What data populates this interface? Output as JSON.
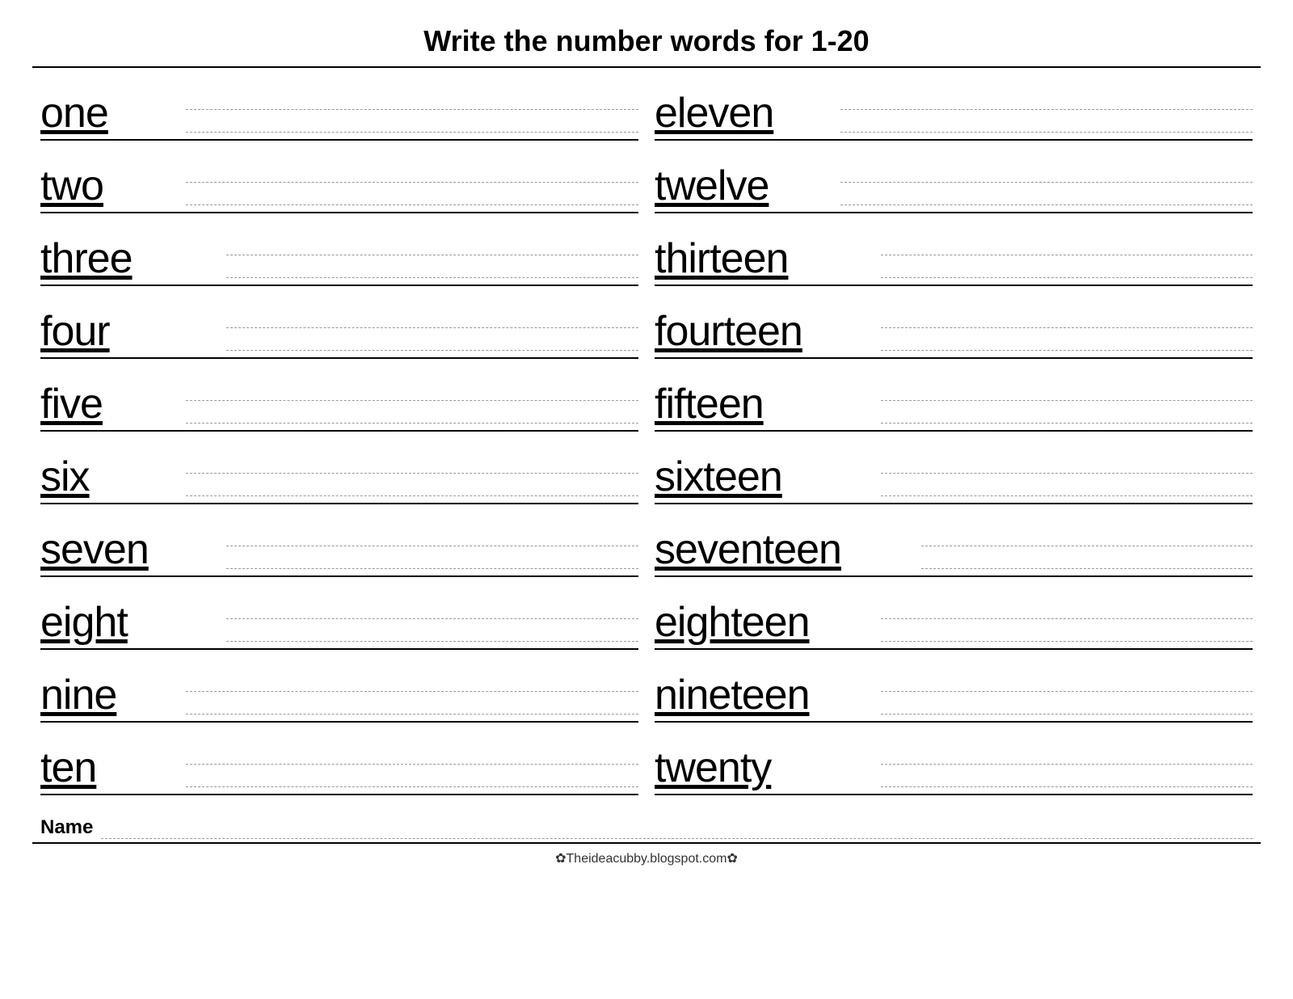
{
  "title": "Write the number words for  1-20",
  "left_column": [
    {
      "word": "one"
    },
    {
      "word": "two"
    },
    {
      "word": "three"
    },
    {
      "word": "four"
    },
    {
      "word": "five"
    },
    {
      "word": "six"
    },
    {
      "word": "seven"
    },
    {
      "word": "eight"
    },
    {
      "word": "nine"
    },
    {
      "word": "ten"
    }
  ],
  "right_column": [
    {
      "word": "eleven"
    },
    {
      "word": "twelve"
    },
    {
      "word": "thirteen"
    },
    {
      "word": "fourteen"
    },
    {
      "word": "fifteen"
    },
    {
      "word": "sixteen"
    },
    {
      "word": "seventeen"
    },
    {
      "word": "eighteen"
    },
    {
      "word": "nineteen"
    },
    {
      "word": "twenty"
    }
  ],
  "name_label": "Name",
  "footer": "✿Theideacubby.blogspot.com✿"
}
